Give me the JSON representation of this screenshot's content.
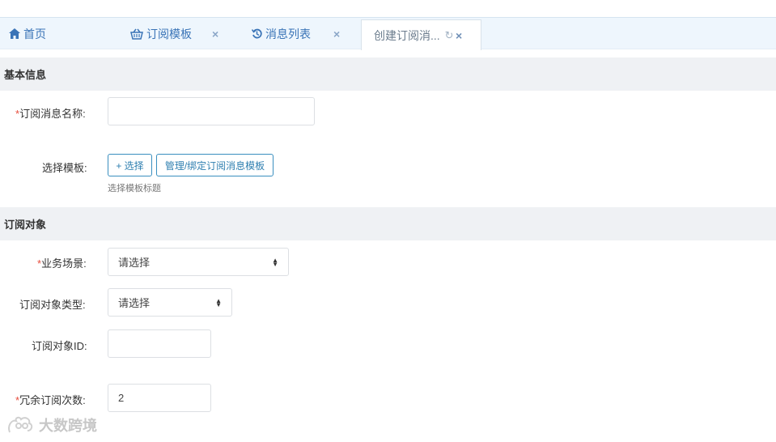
{
  "tabs": [
    {
      "label": "首页",
      "icon": "home-icon"
    },
    {
      "label": "订阅模板",
      "icon": "basket-icon",
      "close": "×"
    },
    {
      "label": "消息列表",
      "icon": "history-icon",
      "close": "×"
    },
    {
      "label": "创建订阅消...",
      "close": "×",
      "refresh": "↻"
    }
  ],
  "sections": {
    "basic_info": "基本信息",
    "subscribe_target": "订阅对象"
  },
  "form": {
    "message_name": {
      "required": "*",
      "label": "订阅消息名称:",
      "value": ""
    },
    "template": {
      "label": "选择模板:",
      "select_button": "+ 选择",
      "manage_button": "管理/绑定订阅消息模板",
      "hint": "选择模板标题"
    },
    "business_scene": {
      "required": "*",
      "label": "业务场景:",
      "value": "请选择"
    },
    "target_type": {
      "label": "订阅对象类型:",
      "value": "请选择"
    },
    "target_id": {
      "label": "订阅对象ID:",
      "value": ""
    },
    "redundant_count": {
      "required": "*",
      "label": "冗余订阅次数:",
      "value": "2"
    }
  },
  "watermark": "大数跨境",
  "colors": {
    "accent": "#3a74b7",
    "button_border": "#3a8fbf",
    "required": "#e74c3c",
    "section_bg": "#eff1f4",
    "tabbar_bg": "#eef6fd"
  }
}
